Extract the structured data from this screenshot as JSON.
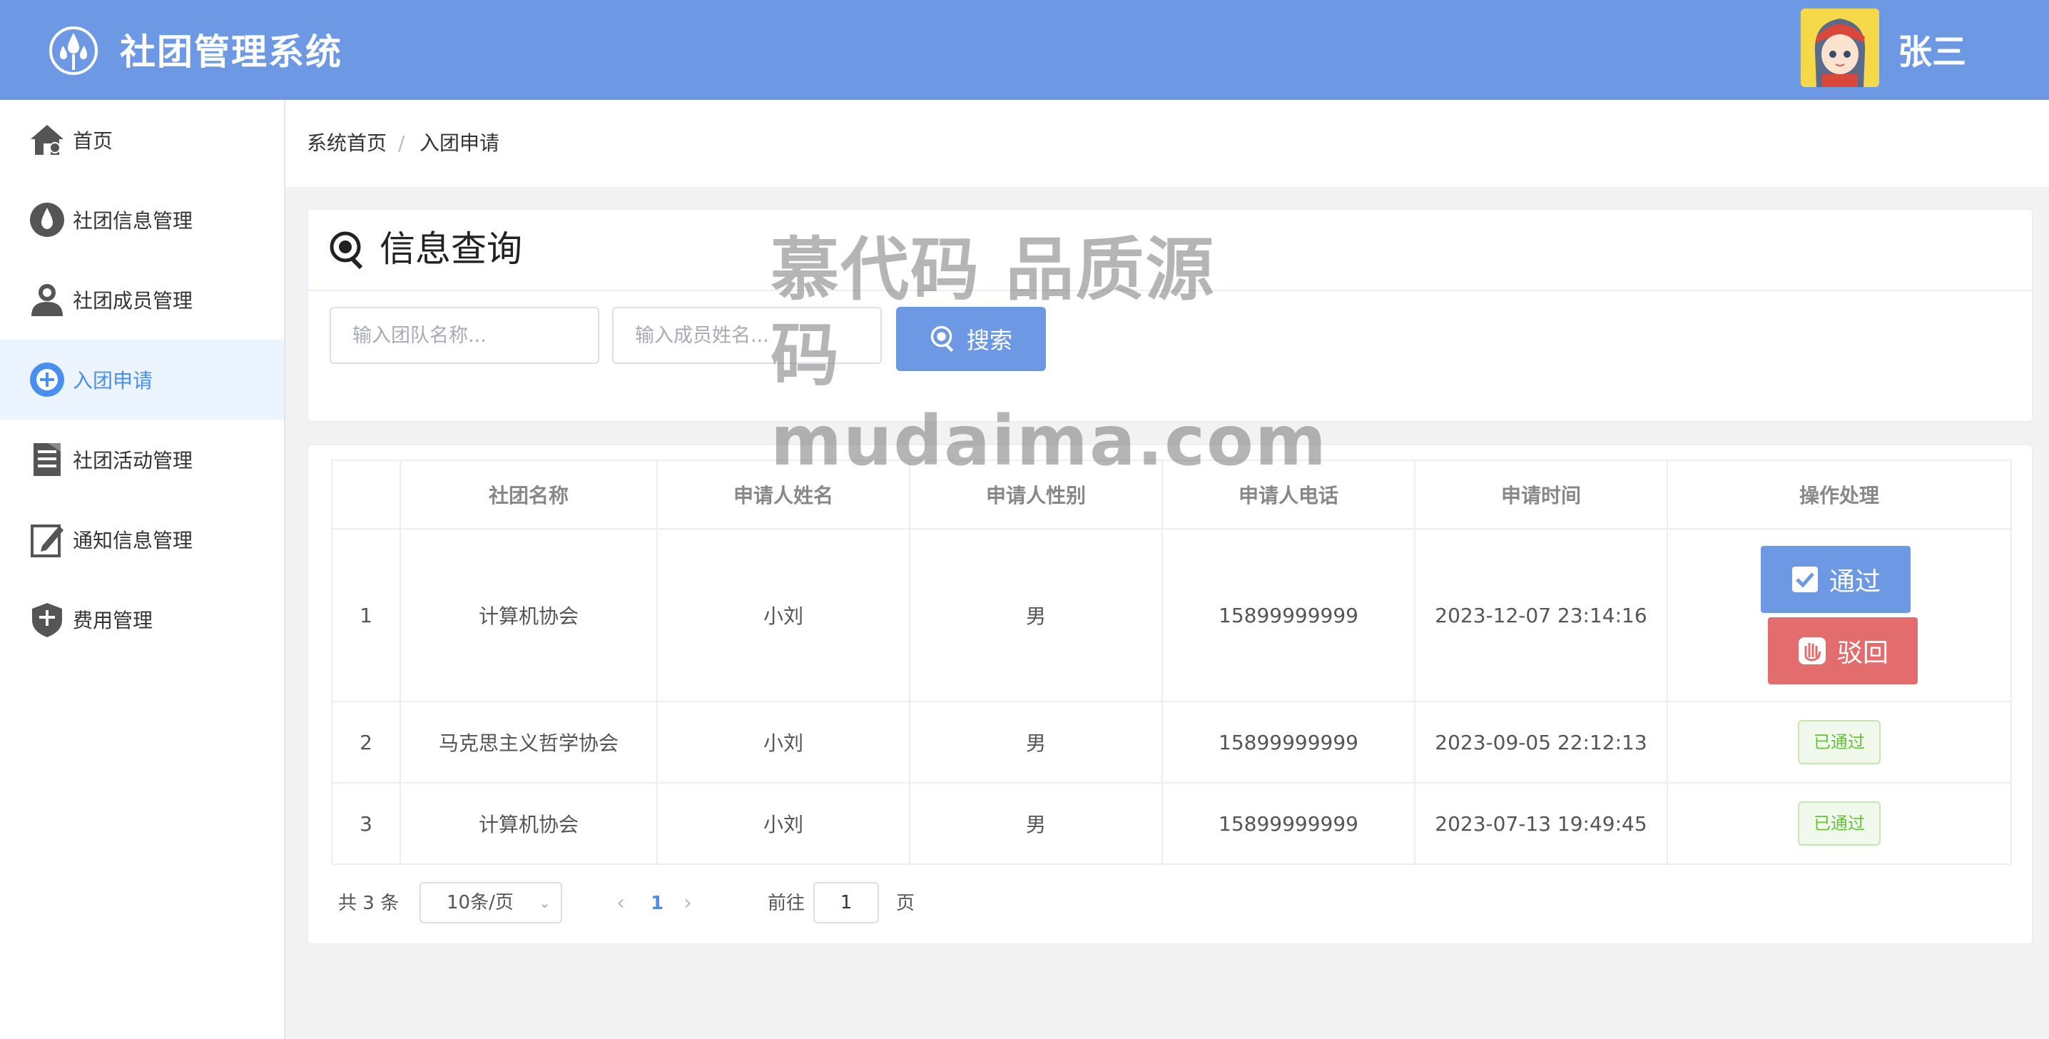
{
  "header": {
    "app_title": "社团管理系统",
    "username": "张三"
  },
  "sidebar": {
    "items": [
      {
        "label": "首页",
        "icon": "home-icon"
      },
      {
        "label": "社团信息管理",
        "icon": "drop-icon"
      },
      {
        "label": "社团成员管理",
        "icon": "user-icon"
      },
      {
        "label": "入团申请",
        "icon": "plus-circle-icon",
        "active": true
      },
      {
        "label": "社团活动管理",
        "icon": "document-icon"
      },
      {
        "label": "通知信息管理",
        "icon": "edit-icon"
      },
      {
        "label": "费用管理",
        "icon": "shield-icon"
      }
    ]
  },
  "breadcrumb": {
    "home": "系统首页",
    "separator": "/",
    "current": "入团申请"
  },
  "search": {
    "title": "信息查询",
    "team_placeholder": "输入团队名称...",
    "member_placeholder": "输入成员姓名...",
    "button_label": "搜索"
  },
  "table": {
    "columns": [
      "",
      "社团名称",
      "申请人姓名",
      "申请人性别",
      "申请人电话",
      "申请时间",
      "操作处理"
    ],
    "rows": [
      {
        "index": "1",
        "club": "计算机协会",
        "name": "小刘",
        "gender": "男",
        "phone": "15899999999",
        "time": "2023-12-07 23:14:16",
        "status": ""
      },
      {
        "index": "2",
        "club": "马克思主义哲学协会",
        "name": "小刘",
        "gender": "男",
        "phone": "15899999999",
        "time": "2023-09-05 22:12:13",
        "status": "已通过"
      },
      {
        "index": "3",
        "club": "计算机协会",
        "name": "小刘",
        "gender": "男",
        "phone": "15899999999",
        "time": "2023-07-13 19:49:45",
        "status": "已通过"
      }
    ],
    "approve_label": "通过",
    "reject_label": "驳回"
  },
  "pagination": {
    "total": "共 3 条",
    "page_size": "10条/页",
    "current_page": "1",
    "goto_label": "前往",
    "goto_value": "1",
    "page_unit": "页"
  },
  "watermark": {
    "line1": "慕代码 品质源码",
    "line2": "mudaima.com"
  },
  "colors": {
    "header": "#6c98e4",
    "active_nav_bg": "#ecf4ff",
    "approve": "#6c98e4",
    "reject": "#e36c6c",
    "success": "#67c23a"
  }
}
